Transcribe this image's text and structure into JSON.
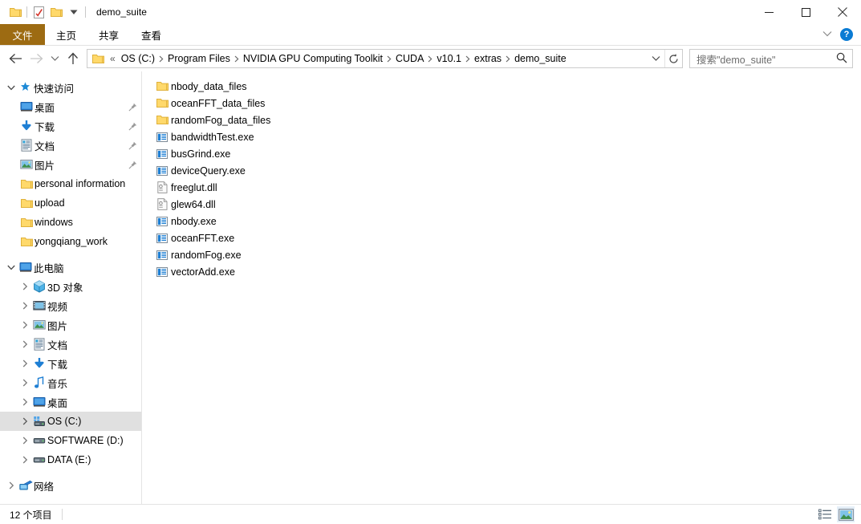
{
  "window": {
    "title": "demo_suite",
    "quick_access_toolbar": [
      {
        "name": "folder-icon",
        "label": "folder"
      },
      {
        "name": "properties-icon",
        "label": "properties"
      },
      {
        "name": "new-folder-icon",
        "label": "new folder"
      },
      {
        "name": "chevron-down-icon",
        "label": "customize quick access toolbar"
      }
    ],
    "controls": {
      "minimize": "—",
      "maximize": "□",
      "close": "✕"
    }
  },
  "ribbon": {
    "tabs": [
      {
        "label": "文件",
        "name": "tab-file",
        "active": true
      },
      {
        "label": "主页",
        "name": "tab-home",
        "active": false
      },
      {
        "label": "共享",
        "name": "tab-share",
        "active": false
      },
      {
        "label": "查看",
        "name": "tab-view",
        "active": false
      }
    ],
    "collapse_icon": "⌄",
    "help_label": "?"
  },
  "navigation": {
    "back": "←",
    "forward": "→",
    "recent": "⌄",
    "up": "↑",
    "overflow": "«",
    "breadcrumbs": [
      "OS (C:)",
      "Program Files",
      "NVIDIA GPU Computing Toolkit",
      "CUDA",
      "v10.1",
      "extras",
      "demo_suite"
    ],
    "separator": "›",
    "address_chevron": "⌄",
    "refresh": "↻"
  },
  "search": {
    "placeholder": "搜索\"demo_suite\"",
    "icon": "search-icon"
  },
  "sidebar": {
    "groups": [
      {
        "name": "quick-access",
        "label": "快速访问",
        "icon": "star-pin-icon",
        "expanded": true,
        "items": [
          {
            "label": "桌面",
            "icon": "desktop-icon",
            "pinned": true
          },
          {
            "label": "下载",
            "icon": "download-icon",
            "pinned": true
          },
          {
            "label": "文档",
            "icon": "documents-icon",
            "pinned": true
          },
          {
            "label": "图片",
            "icon": "pictures-icon",
            "pinned": true
          },
          {
            "label": "personal information",
            "icon": "folder-icon",
            "pinned": false
          },
          {
            "label": "upload",
            "icon": "folder-icon",
            "pinned": false
          },
          {
            "label": "windows",
            "icon": "folder-icon",
            "pinned": false
          },
          {
            "label": "yongqiang_work",
            "icon": "folder-icon",
            "pinned": false
          }
        ]
      },
      {
        "name": "this-pc",
        "label": "此电脑",
        "icon": "computer-icon",
        "expanded": true,
        "items": [
          {
            "label": "3D 对象",
            "icon": "3d-objects-icon",
            "expandable": true,
            "selected": false
          },
          {
            "label": "视频",
            "icon": "videos-icon",
            "expandable": true,
            "selected": false
          },
          {
            "label": "图片",
            "icon": "pictures-icon",
            "expandable": true,
            "selected": false
          },
          {
            "label": "文档",
            "icon": "documents-icon",
            "expandable": true,
            "selected": false
          },
          {
            "label": "下载",
            "icon": "download-icon",
            "expandable": true,
            "selected": false
          },
          {
            "label": "音乐",
            "icon": "music-icon",
            "expandable": true,
            "selected": false
          },
          {
            "label": "桌面",
            "icon": "desktop-icon",
            "expandable": true,
            "selected": false
          },
          {
            "label": "OS (C:)",
            "icon": "local-disk-icon",
            "expandable": true,
            "selected": true
          },
          {
            "label": "SOFTWARE (D:)",
            "icon": "drive-icon",
            "expandable": true,
            "selected": false
          },
          {
            "label": "DATA (E:)",
            "icon": "drive-icon",
            "expandable": true,
            "selected": false
          }
        ]
      },
      {
        "name": "network",
        "label": "网络",
        "icon": "network-icon",
        "expanded": false,
        "items": []
      }
    ]
  },
  "files": [
    {
      "name": "nbody_data_files",
      "type": "folder"
    },
    {
      "name": "oceanFFT_data_files",
      "type": "folder"
    },
    {
      "name": "randomFog_data_files",
      "type": "folder"
    },
    {
      "name": "bandwidthTest.exe",
      "type": "exe"
    },
    {
      "name": "busGrind.exe",
      "type": "exe"
    },
    {
      "name": "deviceQuery.exe",
      "type": "exe"
    },
    {
      "name": "freeglut.dll",
      "type": "dll"
    },
    {
      "name": "glew64.dll",
      "type": "dll"
    },
    {
      "name": "nbody.exe",
      "type": "exe"
    },
    {
      "name": "oceanFFT.exe",
      "type": "exe"
    },
    {
      "name": "randomFog.exe",
      "type": "exe"
    },
    {
      "name": "vectorAdd.exe",
      "type": "exe"
    }
  ],
  "statusbar": {
    "item_count": "12 个项目",
    "views": [
      {
        "name": "details-view-button",
        "active": false
      },
      {
        "name": "large-icons-view-button",
        "active": true
      }
    ]
  },
  "colors": {
    "file_tab": "#9d6b12",
    "selection": "#e0e0e0",
    "folder": "#ffd96b",
    "accent_blue": "#0a7bd4"
  }
}
